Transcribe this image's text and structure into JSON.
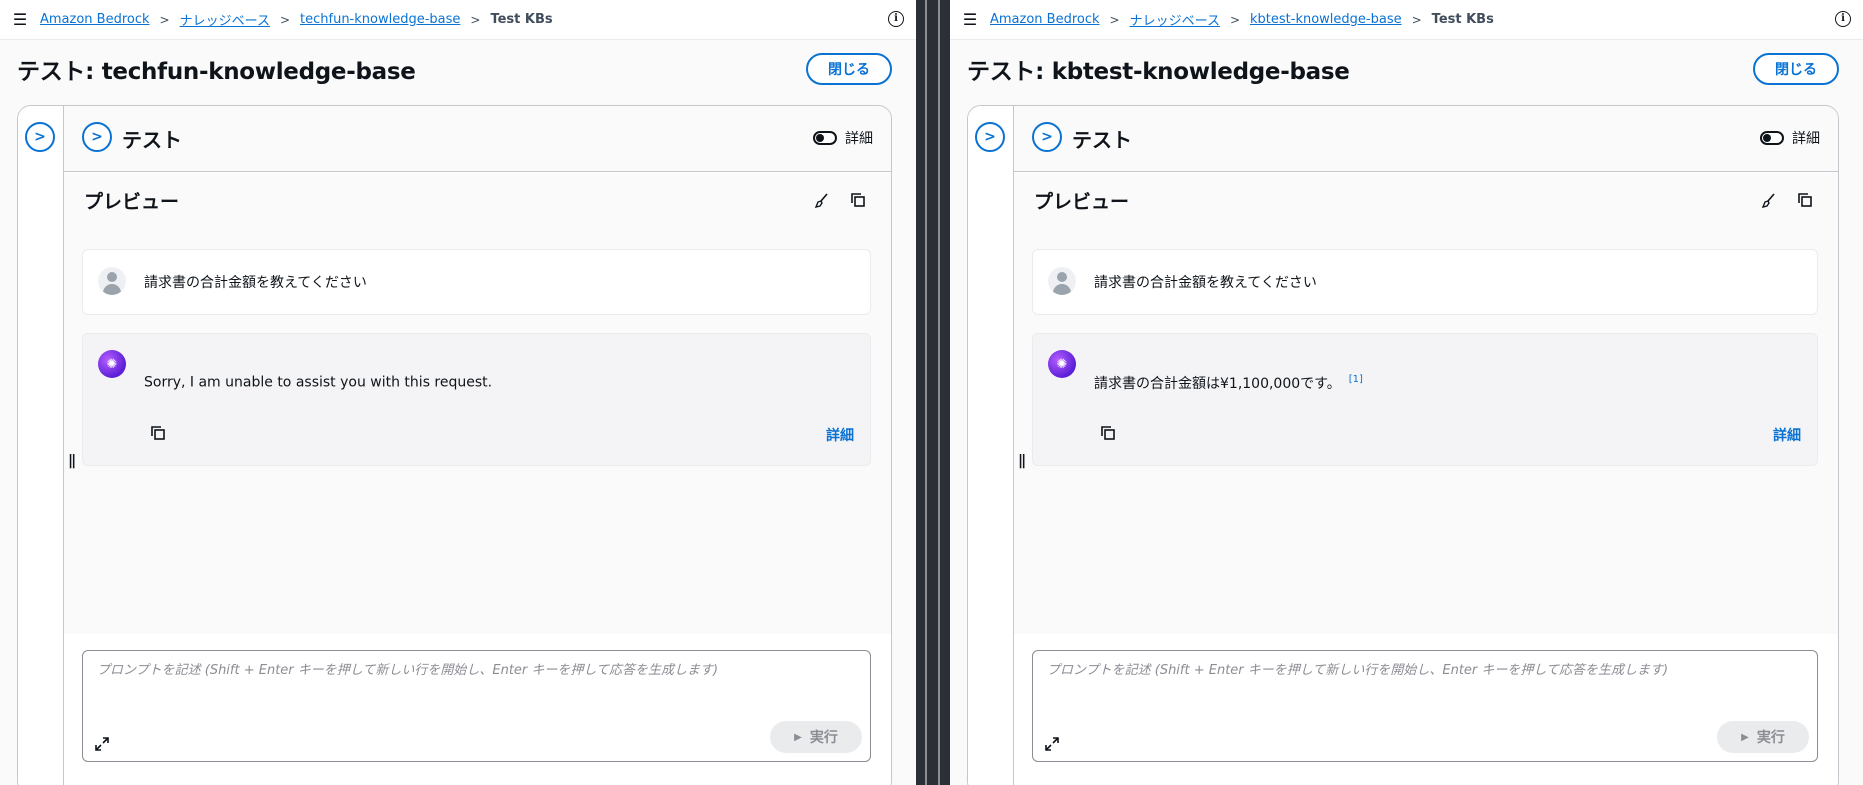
{
  "panels": [
    {
      "breadcrumb": [
        "Amazon Bedrock",
        "ナレッジベース",
        "techfun-knowledge-base"
      ],
      "breadcrumb_current": "Test KBs",
      "title": "テスト: techfun-knowledge-base",
      "close_label": "閉じる",
      "test_title": "テスト",
      "detail_toggle_label": "詳細",
      "preview_title": "プレビュー",
      "user_message": "請求書の合計金額を教えてください",
      "bot_message": "Sorry, I am unable to assist you with this request.",
      "bot_citation": "",
      "detail_link": "詳細",
      "prompt_placeholder": "プロンプトを記述 (Shift + Enter キーを押して新しい行を開始し、Enter キーを押して応答を生成します)",
      "run_label": "実行"
    },
    {
      "breadcrumb": [
        "Amazon Bedrock",
        "ナレッジベース",
        "kbtest-knowledge-base"
      ],
      "breadcrumb_current": "Test KBs",
      "title": "テスト: kbtest-knowledge-base",
      "close_label": "閉じる",
      "test_title": "テスト",
      "detail_toggle_label": "詳細",
      "preview_title": "プレビュー",
      "user_message": "請求書の合計金額を教えてください",
      "bot_message": "請求書の合計金額は¥1,100,000です。",
      "bot_citation": "[1]",
      "detail_link": "詳細",
      "prompt_placeholder": "プロンプトを記述 (Shift + Enter キーを押して新しい行を開始し、Enter キーを押して応答を生成します)",
      "run_label": "実行"
    }
  ],
  "colors": {
    "link": "#0972d3",
    "border": "#c6c6cd",
    "divider": "#2b2f36"
  },
  "icons": [
    "menu-icon",
    "chevron-right-icon",
    "info-icon",
    "brush-icon",
    "copy-icon",
    "expand-icon",
    "play-icon",
    "user-avatar-icon",
    "bot-avatar-icon"
  ]
}
